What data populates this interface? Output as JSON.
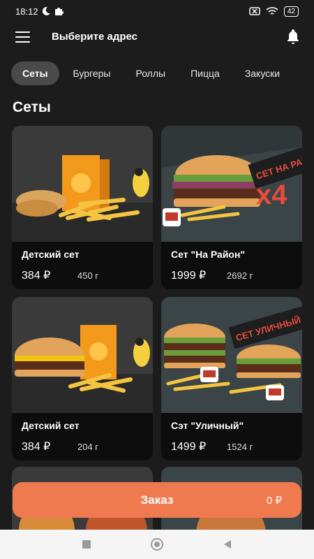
{
  "status": {
    "time": "18:12",
    "battery": "42"
  },
  "header": {
    "address": "Выберите адрес"
  },
  "tabs": [
    {
      "label": "Сеты"
    },
    {
      "label": "Бургеры"
    },
    {
      "label": "Роллы"
    },
    {
      "label": "Пицца"
    },
    {
      "label": "Закуски"
    }
  ],
  "section": {
    "title": "Сеты"
  },
  "products": [
    {
      "name": "Детский сет",
      "price": "384 ₽",
      "weight": "450 г"
    },
    {
      "name": "Сет \"На Район\"",
      "price": "1999 ₽",
      "weight": "2692 г",
      "banner": "СЕТ НА РАЙОН",
      "multiplier": "x4"
    },
    {
      "name": "Детский сет",
      "price": "384 ₽",
      "weight": "204 г"
    },
    {
      "name": "Сэт \"Уличный\"",
      "price": "1499 ₽",
      "weight": "1524 г",
      "banner": "СЕТ УЛИЧНЫЙ"
    }
  ],
  "order": {
    "label": "Заказ",
    "total": "0 ₽"
  }
}
